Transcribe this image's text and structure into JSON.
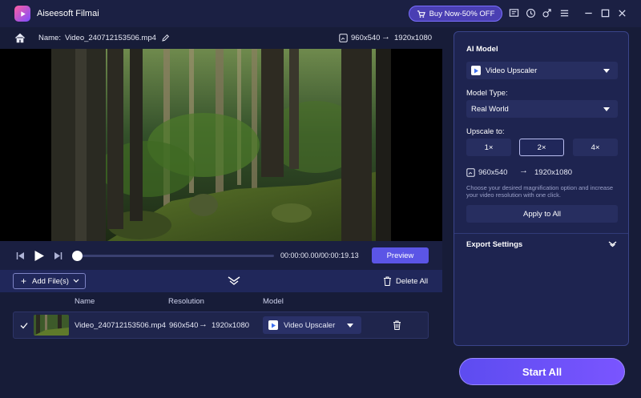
{
  "app": {
    "title": "Aiseesoft Filmai",
    "accent": "#6a4ff5"
  },
  "titlebar": {
    "buy_label": "Buy Now-50% OFF",
    "icons": [
      "cart-icon",
      "feedback-icon",
      "history-icon",
      "gender-icon",
      "menu-icon",
      "minimize-icon",
      "maximize-icon",
      "close-icon"
    ]
  },
  "namebar": {
    "name_label": "Name:",
    "file_name": "Video_240712153506.mp4",
    "source_res": "960x540",
    "target_res": "1920x1080"
  },
  "player": {
    "time": "00:00:00.00/00:00:19.13",
    "preview_label": "Preview",
    "progress": 0
  },
  "filebar": {
    "add_label": "Add File(s)",
    "delete_all_label": "Delete All"
  },
  "list": {
    "columns": {
      "name": "Name",
      "resolution": "Resolution",
      "model": "Model"
    },
    "rows": [
      {
        "name": "Video_240712153506.mp4",
        "src_res": "960x540",
        "dst_res": "1920x1080",
        "model": "Video Upscaler"
      }
    ]
  },
  "panel": {
    "ai_model_title": "AI Model",
    "ai_model_value": "Video Upscaler",
    "model_type_label": "Model Type:",
    "model_type_value": "Real World",
    "upscale_label": "Upscale to:",
    "scales": [
      "1×",
      "2×",
      "4×"
    ],
    "selected_scale": "2×",
    "src_res": "960x540",
    "dst_res": "1920x1080",
    "hint": "Choose your desired magnification option and increase your video resolution with one click.",
    "apply_label": "Apply to All",
    "export_label": "Export Settings",
    "start_label": "Start All"
  }
}
